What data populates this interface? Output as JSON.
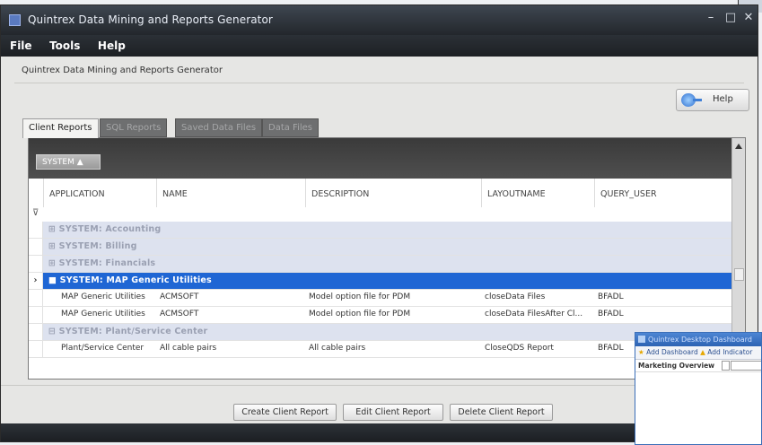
{
  "window": {
    "title": "Quintrex Data Mining and Reports Generator",
    "controls": {
      "minimize": "–",
      "maximize": "□",
      "close": "✕"
    }
  },
  "menu": [
    "File",
    "Tools",
    "Help"
  ],
  "subtitle": "Quintrex Data Mining and Reports Generator",
  "help_button": {
    "label": "Help",
    "icon": "help-globe-icon"
  },
  "tabs": [
    {
      "label": "Client Reports",
      "active": true
    },
    {
      "label": "SQL Reports",
      "active": false
    },
    {
      "label": "Saved Data Files",
      "active": false
    },
    {
      "label": "Data Files",
      "active": false
    }
  ],
  "grid": {
    "group_chip": "SYSTEM ▲",
    "columns": [
      "APPLICATION",
      "NAME",
      "DESCRIPTION",
      "LAYOUTNAME",
      "QUERY_USER"
    ],
    "filter_icon": "filter-funnel-icon",
    "rows": [
      {
        "kind": "group",
        "label": "⊞ SYSTEM: Accounting"
      },
      {
        "kind": "group",
        "label": "⊞ SYSTEM: Billing"
      },
      {
        "kind": "group",
        "label": "⊞ SYSTEM: Financials"
      },
      {
        "kind": "group",
        "label": "■ SYSTEM: MAP Generic Utilities",
        "selected": true,
        "marker": "›"
      },
      {
        "kind": "data",
        "cells": [
          "MAP Generic Utilities",
          "ACMSOFT",
          "Model option file for PDM",
          "closeData Files",
          "BFADL"
        ]
      },
      {
        "kind": "data",
        "cells": [
          "MAP Generic Utilities",
          "ACMSOFT",
          "Model option file for PDM",
          "closeData FilesAfter Cl...",
          "BFADL"
        ]
      },
      {
        "kind": "group",
        "label": "⊟ SYSTEM: Plant/Service Center"
      },
      {
        "kind": "data",
        "cells": [
          "Plant/Service Center",
          "All cable pairs",
          "All cable pairs",
          "CloseQDS Report",
          "BFADL"
        ]
      }
    ]
  },
  "buttons": {
    "create": "Create Client Report",
    "edit": "Edit Client Report",
    "delete": "Delete Client Report"
  },
  "dashboard_window": {
    "title": "Quintrex Desktop Dashboard",
    "toolbar_add_dashboard": "Add Dashboard",
    "toolbar_add_indicator": "Add Indicator",
    "row_label": "Marketing Overview"
  }
}
